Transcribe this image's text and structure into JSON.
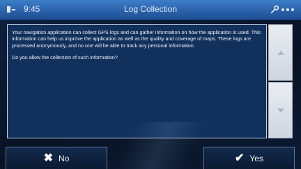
{
  "status": {
    "time": "9:45",
    "menu_icon": "menu-icon",
    "wrench_icon": "wrench-icon"
  },
  "title": "Log Collection",
  "message": {
    "paragraph1": "Your navigation application can collect GPS logs and can gather information on how the application is used. This information can help us improve the application as well as the quality and coverage of maps. These logs are processed anonymously, and no one will be able to track any personal information.",
    "paragraph2": "Do you allow the collection of such information?"
  },
  "buttons": {
    "no_label": "No",
    "yes_label": "Yes",
    "no_icon": "close-icon",
    "yes_icon": "check-icon"
  },
  "scroll": {
    "up_icon": "arrow-up-icon",
    "down_icon": "arrow-down-icon"
  }
}
